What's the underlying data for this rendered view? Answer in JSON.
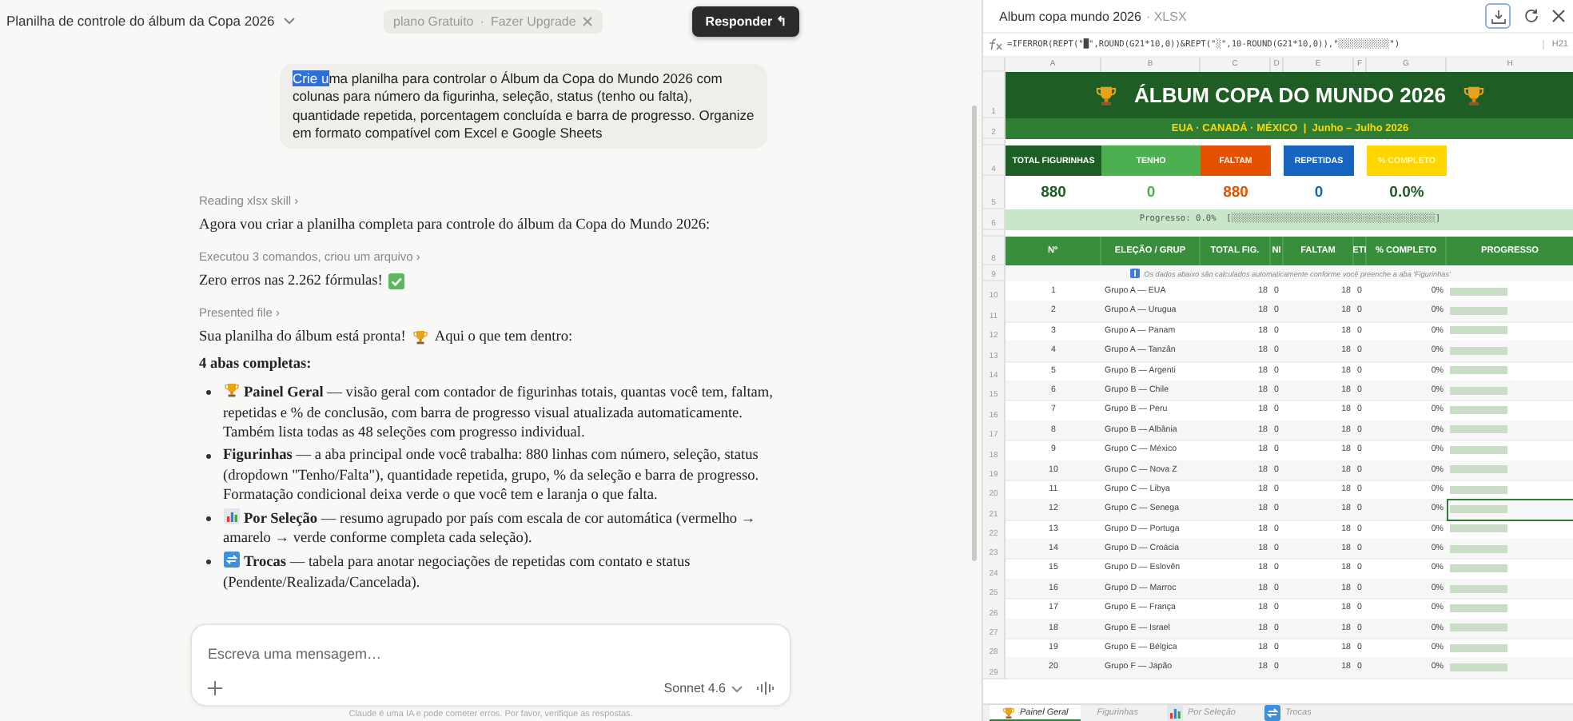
{
  "chat": {
    "title": "Planilha de controle do álbum da Copa 2026",
    "banner": {
      "plan": "plano Gratuito",
      "separator": "·",
      "upgrade": "Fazer Upgrade"
    },
    "reply_button": "Responder ↰",
    "user_message": {
      "selected_text": "Crie u",
      "text": "ma planilha para controlar o Álbum da Copa do Mundo 2026 com colunas para número da figurinha, seleção, status (tenho ou falta), quantidade repetida, porcentagem concluída e barra de progresso. Organize em formato compatível com Excel e Google Sheets"
    },
    "steps": [
      {
        "kind": "step",
        "text": "Reading xlsx skill ›"
      },
      {
        "kind": "text",
        "text": "Agora vou criar a planilha completa para controle do álbum da Copa do Mundo 2026:"
      },
      {
        "kind": "step",
        "text": "Executou 3 comandos, criou um arquivo ›"
      },
      {
        "kind": "check",
        "text": "Zero erros nas 2.262 fórmulas!"
      },
      {
        "kind": "step",
        "text": "Presented file ›"
      },
      {
        "kind": "trophy",
        "text": "Sua planilha do álbum está pronta!",
        "after": "Aqui o que tem dentro:"
      },
      {
        "kind": "heading",
        "text": "4 abas completas:"
      }
    ],
    "bullets": [
      {
        "kind": "trophy",
        "text": "**Painel Geral** — visão geral com contador de figurinhas totais, quantas você tem, faltam, repetidas e % de conclusão, com barra de progresso visual atualizada automaticamente. Também lista todas as 48 seleções com progresso individual."
      },
      {
        "kind": "plain",
        "text": "**Figurinhas** — a aba principal onde você trabalha: 880 linhas com número, seleção, status (dropdown \"Tenho/Falta\"), quantidade repetida, grupo, % da seleção e barra de progresso. Formatação condicional deixa verde o que você tem e laranja o que falta."
      },
      {
        "kind": "chart",
        "text": "**Por Seleção** — resumo agrupado por país com escala de cor automática (vermelho → amarelo → verde conforme completa cada seleção)."
      },
      {
        "kind": "swap",
        "text": "**Trocas** — tabela para anotar negociações de repetidas com contato e status (Pendente/Realizada/Cancelada)."
      }
    ],
    "composer": {
      "placeholder": "Escreva uma mensagem…",
      "model": "Sonnet 4.6"
    },
    "disclaimer": "Claude é uma IA e pode cometer erros. Por favor, verifique as respostas."
  },
  "viewer": {
    "title": "Album copa mundo 2026",
    "file_type": "· XLSX",
    "formula": "=IFERROR(REPT(\"█\",ROUND(G21*10,0))&REPT(\"░\",10-ROUND(G21*10,0)),\"░░░░░░░░░░\")",
    "cell_ref": "H21",
    "columns": [
      "A",
      "B",
      "C",
      "D",
      "E",
      "F",
      "G",
      "H"
    ],
    "title_row": {
      "number": "1",
      "text": "ÁLBUM COPA DO MUNDO 2026"
    },
    "subtitle_row": {
      "number": "2",
      "text": "EUA · CANADÁ · MÉXICO  |  Junho – Julho 2026"
    },
    "stat_rows": [
      "4",
      "5"
    ],
    "stats": [
      {
        "label": "TOTAL FIGURINHAS",
        "value": "880",
        "color": "#1e5e25"
      },
      {
        "label": "TENHO",
        "value": "0",
        "color": "#4caf50"
      },
      {
        "label": "FALTAM",
        "value": "880",
        "color": "#e65100"
      },
      {
        "label": "REPETIDAS",
        "value": "0",
        "color": "#1565c0"
      },
      {
        "label": "% COMPLETO",
        "value": "0.0%",
        "color": "#ffd600"
      }
    ],
    "progress_row": {
      "number": "6",
      "text": "Progresso: 0.0%  [░░░░░░░░░░░░░░░░░░░░░░░░░░░░░░░░░░░░░░░░]"
    },
    "header_row": {
      "number": "8",
      "cells": [
        "Nº",
        "ELEÇÃO / GRUP",
        "TOTAL FIG.",
        "NI",
        "FALTAM",
        "ETI",
        "% COMPLETO",
        "PROGRESSO"
      ]
    },
    "note_row": {
      "number": "9",
      "text": "Os dados abaixo são calculados automaticamente conforme você preenche a aba 'Figurinhas'"
    },
    "rows": [
      {
        "number": "10",
        "cells": [
          "1",
          "Grupo A — EUA",
          "18",
          "0",
          "18",
          "0",
          "0%"
        ],
        "level": 0,
        "selected": false
      },
      {
        "number": "11",
        "cells": [
          "2",
          "Grupo A — Urugua",
          "18",
          "0",
          "18",
          "0",
          "0%"
        ],
        "level": 0,
        "selected": false
      },
      {
        "number": "12",
        "cells": [
          "3",
          "Grupo A — Panam",
          "18",
          "0",
          "18",
          "0",
          "0%"
        ],
        "level": 0,
        "selected": false
      },
      {
        "number": "13",
        "cells": [
          "4",
          "Grupo A — Tanzân",
          "18",
          "0",
          "18",
          "0",
          "0%"
        ],
        "level": 0,
        "selected": false
      },
      {
        "number": "14",
        "cells": [
          "5",
          "Grupo B — Argenti",
          "18",
          "0",
          "18",
          "0",
          "0%"
        ],
        "level": 0,
        "selected": false
      },
      {
        "number": "15",
        "cells": [
          "6",
          "Grupo B — Chile",
          "18",
          "0",
          "18",
          "0",
          "0%"
        ],
        "level": 0,
        "selected": false
      },
      {
        "number": "16",
        "cells": [
          "7",
          "Grupo B — Peru",
          "18",
          "0",
          "18",
          "0",
          "0%"
        ],
        "level": 0,
        "selected": false
      },
      {
        "number": "17",
        "cells": [
          "8",
          "Grupo B — Albânia",
          "18",
          "0",
          "18",
          "0",
          "0%"
        ],
        "level": 0,
        "selected": false
      },
      {
        "number": "18",
        "cells": [
          "9",
          "Grupo C — México",
          "18",
          "0",
          "18",
          "0",
          "0%"
        ],
        "level": 0,
        "selected": false
      },
      {
        "number": "19",
        "cells": [
          "10",
          "Grupo C — Nova Z",
          "18",
          "0",
          "18",
          "0",
          "0%"
        ],
        "level": 0,
        "selected": false
      },
      {
        "number": "20",
        "cells": [
          "11",
          "Grupo C — Libya",
          "18",
          "0",
          "18",
          "0",
          "0%"
        ],
        "level": 0,
        "selected": false
      },
      {
        "number": "21",
        "cells": [
          "12",
          "Grupo C — Senega",
          "18",
          "0",
          "18",
          "0",
          "0%"
        ],
        "level": 0,
        "selected": true
      },
      {
        "number": "22",
        "cells": [
          "13",
          "Grupo D — Portuga",
          "18",
          "0",
          "18",
          "0",
          "0%"
        ],
        "level": 0,
        "selected": false
      },
      {
        "number": "23",
        "cells": [
          "14",
          "Grupo D — Croácia",
          "18",
          "0",
          "18",
          "0",
          "0%"
        ],
        "level": 0,
        "selected": false
      },
      {
        "number": "24",
        "cells": [
          "15",
          "Grupo D — Eslovên",
          "18",
          "0",
          "18",
          "0",
          "0%"
        ],
        "level": 0,
        "selected": false
      },
      {
        "number": "25",
        "cells": [
          "16",
          "Grupo D — Marroc",
          "18",
          "0",
          "18",
          "0",
          "0%"
        ],
        "level": 0,
        "selected": false
      },
      {
        "number": "26",
        "cells": [
          "17",
          "Grupo E — França",
          "18",
          "0",
          "18",
          "0",
          "0%"
        ],
        "level": 0,
        "selected": false
      },
      {
        "number": "27",
        "cells": [
          "18",
          "Grupo E — Israel",
          "18",
          "0",
          "18",
          "0",
          "0%"
        ],
        "level": 0,
        "selected": false
      },
      {
        "number": "28",
        "cells": [
          "19",
          "Grupo E — Bélgica",
          "18",
          "0",
          "18",
          "0",
          "0%"
        ],
        "level": 0,
        "selected": false
      },
      {
        "number": "29",
        "cells": [
          "20",
          "Grupo F — Japão",
          "18",
          "0",
          "18",
          "0",
          "0%"
        ],
        "level": 0,
        "selected": false
      }
    ],
    "tabs": [
      {
        "label": "Painel Geral",
        "kind": "trophy",
        "selected": true
      },
      {
        "label": "Figurinhas",
        "kind": "plain",
        "selected": false
      },
      {
        "label": "Por Seleção",
        "kind": "chart",
        "selected": false
      },
      {
        "label": "Trocas",
        "kind": "swap",
        "selected": false
      }
    ]
  }
}
